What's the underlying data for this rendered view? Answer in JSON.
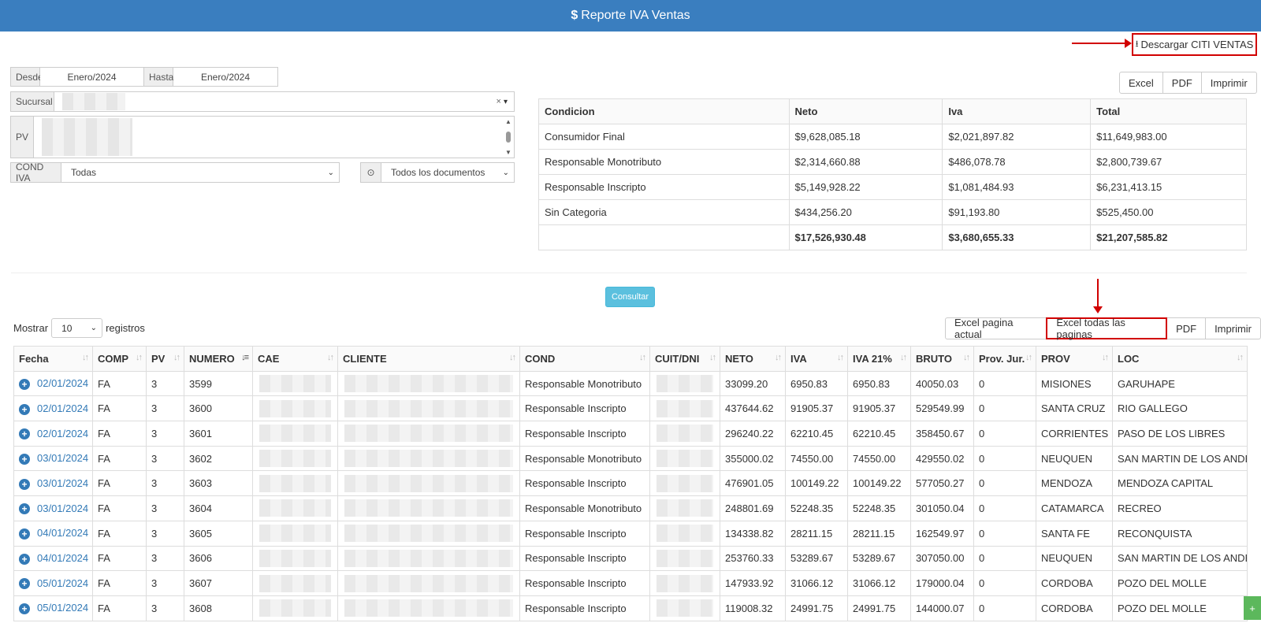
{
  "header": {
    "title": "Reporte IVA Ventas"
  },
  "citi_button": {
    "label": "Descargar CITI VENTAS"
  },
  "filters": {
    "desde_label": "Desde",
    "desde_value": "Enero/2024",
    "hasta_label": "Hasta",
    "hasta_value": "Enero/2024",
    "sucursal_label": "Sucursal",
    "pv_label": "PV",
    "cond_iva_label": "COND IVA",
    "cond_iva_value": "Todas",
    "docs_value": "Todos los documentos",
    "clear_icon": "×"
  },
  "summary_buttons": {
    "excel": "Excel",
    "pdf": "PDF",
    "imprimir": "Imprimir"
  },
  "summary": {
    "headers": [
      "Condicion",
      "Neto",
      "Iva",
      "Total"
    ],
    "rows": [
      [
        "Consumidor Final",
        "$9,628,085.18",
        "$2,021,897.82",
        "$11,649,983.00"
      ],
      [
        "Responsable Monotributo",
        "$2,314,660.88",
        "$486,078.78",
        "$2,800,739.67"
      ],
      [
        "Responsable Inscripto",
        "$5,149,928.22",
        "$1,081,484.93",
        "$6,231,413.15"
      ],
      [
        "Sin Categoria",
        "$434,256.20",
        "$91,193.80",
        "$525,450.00"
      ]
    ],
    "totals": [
      "",
      "$17,526,930.48",
      "$3,680,655.33",
      "$21,207,585.82"
    ]
  },
  "consultar_label": "Consultar",
  "length": {
    "prefix": "Mostrar",
    "value": "10",
    "suffix": "registros"
  },
  "table_buttons": {
    "excel_actual": "Excel pagina actual",
    "excel_todas": "Excel todas las paginas",
    "pdf": "PDF",
    "imprimir": "Imprimir"
  },
  "table": {
    "headers": [
      "Fecha",
      "COMP",
      "PV",
      "NUMERO",
      "CAE",
      "CLIENTE",
      "COND",
      "CUIT/DNI",
      "NETO",
      "IVA",
      "IVA 21%",
      "BRUTO",
      "Prov. Jur.",
      "PROV",
      "LOC"
    ],
    "rows": [
      [
        "02/01/2024",
        "FA",
        "3",
        "3599",
        "Responsable Monotributo",
        "33099.20",
        "6950.83",
        "6950.83",
        "40050.03",
        "0",
        "MISIONES",
        "GARUHAPE"
      ],
      [
        "02/01/2024",
        "FA",
        "3",
        "3600",
        "Responsable Inscripto",
        "437644.62",
        "91905.37",
        "91905.37",
        "529549.99",
        "0",
        "SANTA CRUZ",
        "RIO GALLEGO"
      ],
      [
        "02/01/2024",
        "FA",
        "3",
        "3601",
        "Responsable Inscripto",
        "296240.22",
        "62210.45",
        "62210.45",
        "358450.67",
        "0",
        "CORRIENTES",
        "PASO DE LOS LIBRES"
      ],
      [
        "03/01/2024",
        "FA",
        "3",
        "3602",
        "Responsable Monotributo",
        "355000.02",
        "74550.00",
        "74550.00",
        "429550.02",
        "0",
        "NEUQUEN",
        "SAN MARTIN DE LOS ANDES"
      ],
      [
        "03/01/2024",
        "FA",
        "3",
        "3603",
        "Responsable Inscripto",
        "476901.05",
        "100149.22",
        "100149.22",
        "577050.27",
        "0",
        "MENDOZA",
        "MENDOZA CAPITAL"
      ],
      [
        "03/01/2024",
        "FA",
        "3",
        "3604",
        "Responsable Monotributo",
        "248801.69",
        "52248.35",
        "52248.35",
        "301050.04",
        "0",
        "CATAMARCA",
        "RECREO"
      ],
      [
        "04/01/2024",
        "FA",
        "3",
        "3605",
        "Responsable Inscripto",
        "134338.82",
        "28211.15",
        "28211.15",
        "162549.97",
        "0",
        "SANTA FE",
        "RECONQUISTA"
      ],
      [
        "04/01/2024",
        "FA",
        "3",
        "3606",
        "Responsable Inscripto",
        "253760.33",
        "53289.67",
        "53289.67",
        "307050.00",
        "0",
        "NEUQUEN",
        "SAN MARTIN DE LOS ANDES"
      ],
      [
        "05/01/2024",
        "FA",
        "3",
        "3607",
        "Responsable Inscripto",
        "147933.92",
        "31066.12",
        "31066.12",
        "179000.04",
        "0",
        "CORDOBA",
        "POZO DEL MOLLE"
      ],
      [
        "05/01/2024",
        "FA",
        "3",
        "3608",
        "Responsable Inscripto",
        "119008.32",
        "24991.75",
        "24991.75",
        "144000.07",
        "0",
        "CORDOBA",
        "POZO DEL MOLLE"
      ]
    ]
  },
  "float_button": {
    "label": "+"
  },
  "colors": {
    "header_bg": "#3a7ebf",
    "highlight": "#d10000",
    "consultar": "#5bc0de",
    "link": "#337ab7"
  }
}
